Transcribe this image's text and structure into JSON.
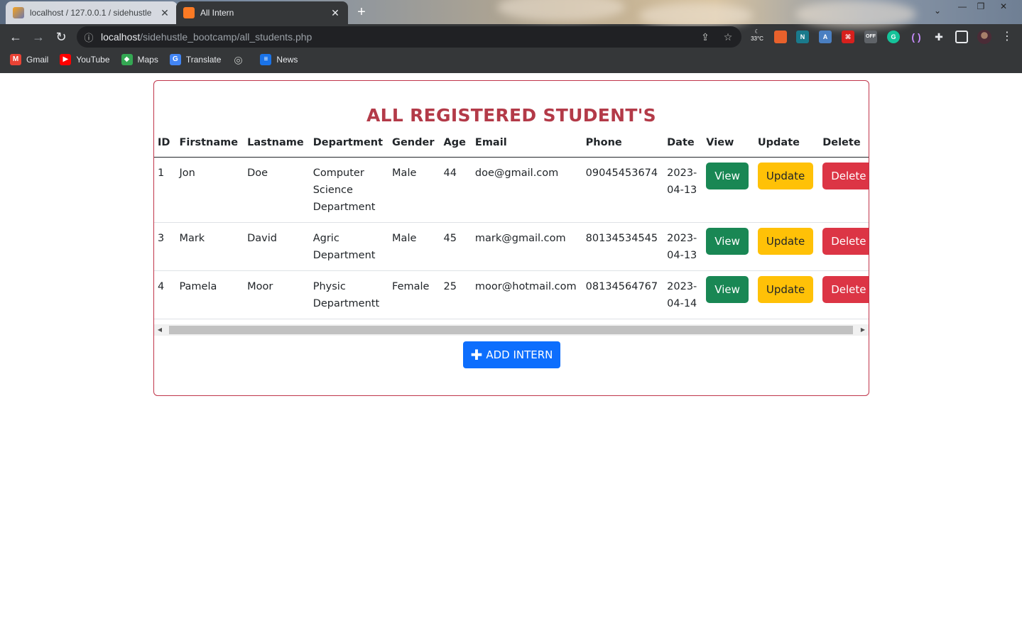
{
  "browser": {
    "tabs": [
      {
        "title": "localhost / 127.0.0.1 / sidehustle",
        "close": "✕"
      },
      {
        "title": "All Intern",
        "close": "✕"
      }
    ],
    "new_tab": "+",
    "url_host": "localhost",
    "url_path": "/sidehustle_bootcamp/all_students.php",
    "weather": "33°C",
    "bookmarks": [
      "Gmail",
      "YouTube",
      "Maps",
      "Translate",
      "",
      "News"
    ]
  },
  "page": {
    "heading": "ALL REGISTERED STUDENT'S",
    "columns": [
      "ID",
      "Firstname",
      "Lastname",
      "Department",
      "Gender",
      "Age",
      "Email",
      "Phone",
      "Date",
      "View",
      "Update",
      "Delete"
    ],
    "rows": [
      {
        "id": "1",
        "firstname": "Jon",
        "lastname": "Doe",
        "department": "Computer Science Department",
        "gender": "Male",
        "age": "44",
        "email": "doe@gmail.com",
        "phone": "09045453674",
        "date": "2023-04-13"
      },
      {
        "id": "3",
        "firstname": "Mark",
        "lastname": "David",
        "department": "Agric Department",
        "gender": "Male",
        "age": "45",
        "email": "mark@gmail.com",
        "phone": "80134534545",
        "date": "2023-04-13"
      },
      {
        "id": "4",
        "firstname": "Pamela",
        "lastname": "Moor",
        "department": "Physic Departmentt",
        "gender": "Female",
        "age": "25",
        "email": "moor@hotmail.com",
        "phone": "08134564767",
        "date": "2023-04-14"
      }
    ],
    "buttons": {
      "view": "View",
      "update": "Update",
      "delete": "Delete"
    },
    "add_button": "ADD INTERN"
  },
  "colors": {
    "heading": "#b33a48",
    "card_border": "#c0354a",
    "view": "#198754",
    "update": "#ffc107",
    "delete": "#dc3545",
    "add": "#0d6efd"
  }
}
